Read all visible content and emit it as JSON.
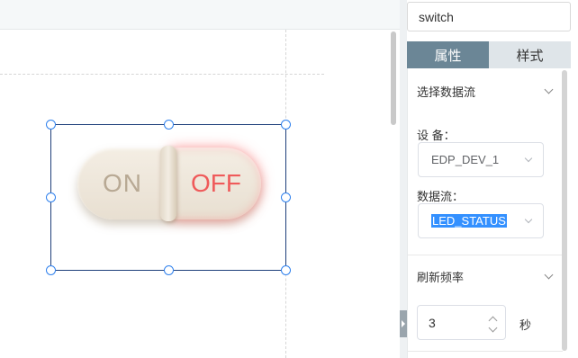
{
  "canvas": {
    "widget": {
      "on_label": "ON",
      "off_label": "OFF",
      "state": "off"
    }
  },
  "panel": {
    "name_value": "switch",
    "tabs": [
      {
        "label": "属性",
        "active": true
      },
      {
        "label": "样式",
        "active": false
      }
    ],
    "datastream_section": {
      "title": "选择数据流",
      "device_label": "设 备：",
      "device_value": "EDP_DEV_1",
      "stream_label": "数据流：",
      "stream_value": "LED_STATUS"
    },
    "refresh_section": {
      "title": "刷新频率",
      "value": "3",
      "unit": "秒"
    }
  },
  "icons": [
    "chevron-down-icon",
    "caret-right-icon",
    "stepper-up-icon",
    "stepper-down-icon"
  ],
  "colors": {
    "tab_active_bg": "#6b8696",
    "selection_border": "#1e3f7a",
    "handle_border": "#2f80ed",
    "off_text": "#ef5a5a",
    "highlight": "#3390ff"
  }
}
